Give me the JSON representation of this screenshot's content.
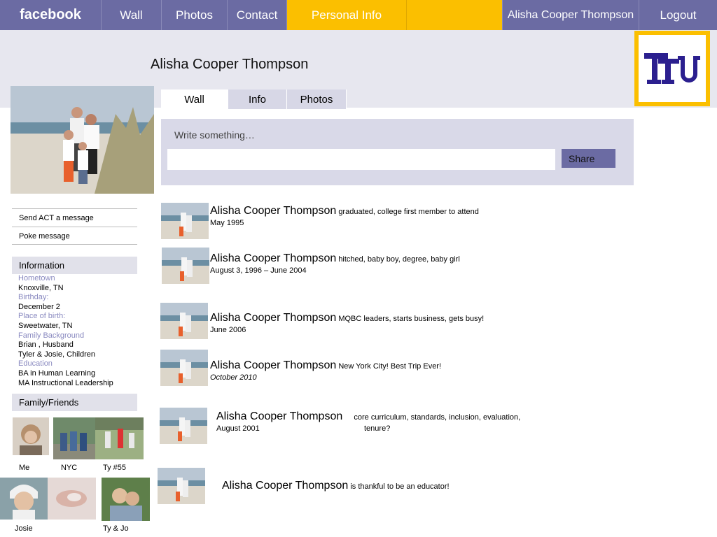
{
  "nav": {
    "logo": "facebook",
    "wall": "Wall",
    "photos": "Photos",
    "contact": "Contact",
    "personal": "Personal Info",
    "user": "Alisha Cooper Thompson",
    "logout": "Logout"
  },
  "profile": {
    "name": "Alisha Cooper Thompson"
  },
  "school_logo": {
    "text": "TTU",
    "color": "#2b1f8f"
  },
  "tabs": {
    "wall": "Wall",
    "info": "Info",
    "photos": "Photos"
  },
  "composer": {
    "label": "Write something…",
    "value": "",
    "share": "Share"
  },
  "sidebar": {
    "send_message": "Send ACT a message",
    "poke": "Poke message",
    "info_heading": "Information",
    "info": [
      {
        "label": "Hometown",
        "values": [
          "Knoxville, TN"
        ]
      },
      {
        "label": "Birthday:",
        "values": [
          "December 2"
        ]
      },
      {
        "label": "Place of birth:",
        "values": [
          "Sweetwater, TN"
        ]
      },
      {
        "label": "Family Background",
        "values": [
          "Brian , Husband",
          "Tyler & Josie, Children"
        ]
      },
      {
        "label": "Education",
        "values": [
          "BA in Human Learning",
          "MA Instructional Leadership"
        ]
      }
    ],
    "friends_heading": "Family/Friends",
    "friends": [
      {
        "label": "Me"
      },
      {
        "label": "NYC"
      },
      {
        "label": "Ty #55"
      },
      {
        "label": ""
      },
      {
        "label": "Josie"
      },
      {
        "label": ""
      },
      {
        "label": "Ty & Jo"
      }
    ]
  },
  "feed": [
    {
      "name": "Alisha Cooper Thompson",
      "text": "graduated, college first  member to attend",
      "date": "May 1995"
    },
    {
      "name": "Alisha Cooper Thompson",
      "text": "hitched, baby boy, degree, baby girl",
      "date": "August 3, 1996 – June 2004"
    },
    {
      "name": "Alisha Cooper Thompson",
      "text": "MQBC leaders, starts business, gets busy!",
      "date": "June 2006"
    },
    {
      "name": "Alisha Cooper Thompson",
      "text": "New York City!  Best Trip Ever!",
      "date": "October 2010"
    },
    {
      "name": "Alisha Cooper Thompson",
      "text": "core curriculum, standards, inclusion, evaluation,",
      "text2": "tenure?",
      "date": "August 2001"
    },
    {
      "name": "Alisha Cooper Thompson",
      "text": "is thankful to be an educator!",
      "date": ""
    }
  ]
}
